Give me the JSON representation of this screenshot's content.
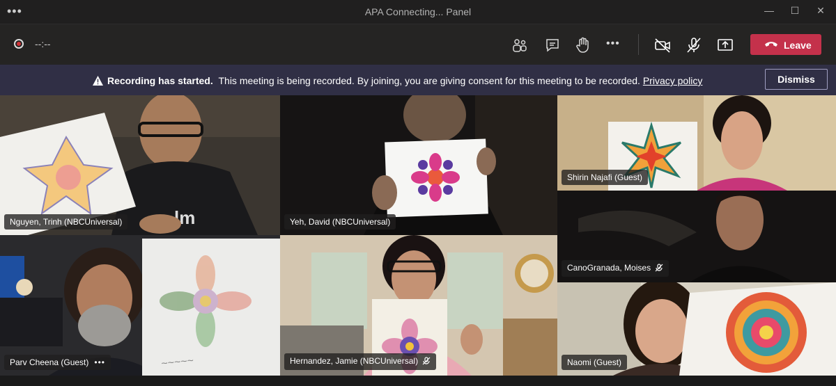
{
  "window": {
    "title": "APA Connecting... Panel",
    "more_glyph": "•••",
    "minimize_glyph": "—",
    "maximize_glyph": "☐",
    "close_glyph": "✕"
  },
  "toolbar": {
    "timer": "--:--",
    "more_glyph": "•••",
    "leave_label": "Leave",
    "icons": [
      "participants-icon",
      "chat-icon",
      "raise-hand-icon",
      "more-actions-icon",
      "camera-off-icon",
      "mic-off-icon",
      "share-screen-icon"
    ]
  },
  "banner": {
    "bold": "Recording has started.",
    "text": "This meeting is being recorded. By joining, you are giving consent for this meeting to be recorded.",
    "link": "Privacy policy",
    "dismiss": "Dismiss"
  },
  "participants": [
    {
      "name": "Nguyen, Trinh (NBCUniversal)",
      "muted": false
    },
    {
      "name": "Yeh, David (NBCUniversal)",
      "muted": false
    },
    {
      "name": "Shirin Najafi (Guest)",
      "muted": false
    },
    {
      "name": "CanoGranada, Moises",
      "muted": true
    },
    {
      "name": "Parv Cheena (Guest)",
      "muted": false,
      "more": "•••"
    },
    {
      "name": "Hernandez, Jamie (NBCUniversal)",
      "muted": true
    },
    {
      "name": "Naomi (Guest)",
      "muted": false
    }
  ],
  "colors": {
    "leave": "#c4314b",
    "banner": "#302f45",
    "toolbar": "#252423"
  }
}
